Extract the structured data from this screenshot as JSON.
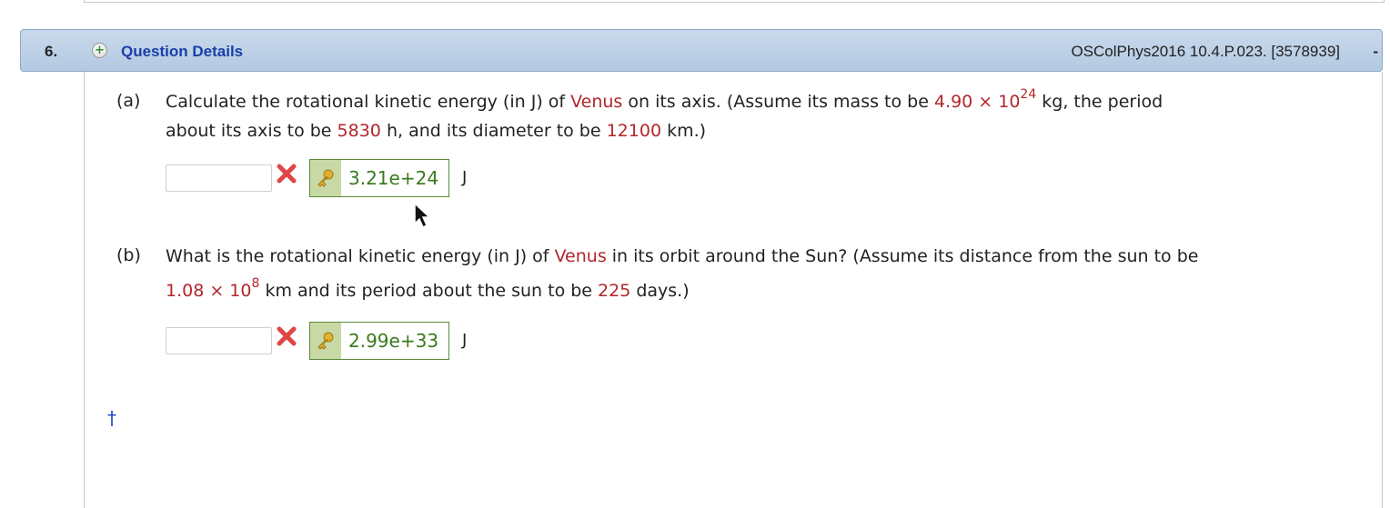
{
  "question": {
    "number": "6.",
    "details_label": "Question Details",
    "id": "OSColPhys2016 10.4.P.023. [3578939]",
    "collapse": "-"
  },
  "part_a": {
    "label": "(a)",
    "line1_pre": "Calculate the rotational kinetic energy (in J) of ",
    "planet": "Venus",
    "line1_mid": " on its axis. (Assume its mass to be ",
    "mass": "4.90 × 10",
    "mass_exp": "24",
    "line1_post": " kg, the period",
    "line2_pre": "about its axis to be ",
    "period": "5830",
    "line2_mid": " h, and its diameter to be ",
    "diameter": "12100",
    "line2_post": " km.)",
    "input_value": "",
    "answer": "3.21e+24",
    "unit": "J"
  },
  "part_b": {
    "label": "(b)",
    "line1_pre": "What is the rotational kinetic energy (in J) of ",
    "planet": "Venus",
    "line1_post": " in its orbit around the Sun? (Assume its distance from the sun to be",
    "distance": "1.08 × 10",
    "distance_exp": "8",
    "line2_mid": " km and its period about the sun to be ",
    "period": "225",
    "line2_post": " days.)",
    "input_value": "",
    "answer": "2.99e+33",
    "unit": "J"
  },
  "footer": {
    "dagger": "†"
  },
  "colors": {
    "header": "#b3c9e2",
    "highlight_red": "#b3262b",
    "answer_green": "#3b7a1e",
    "link_blue": "#1a3fa8"
  }
}
